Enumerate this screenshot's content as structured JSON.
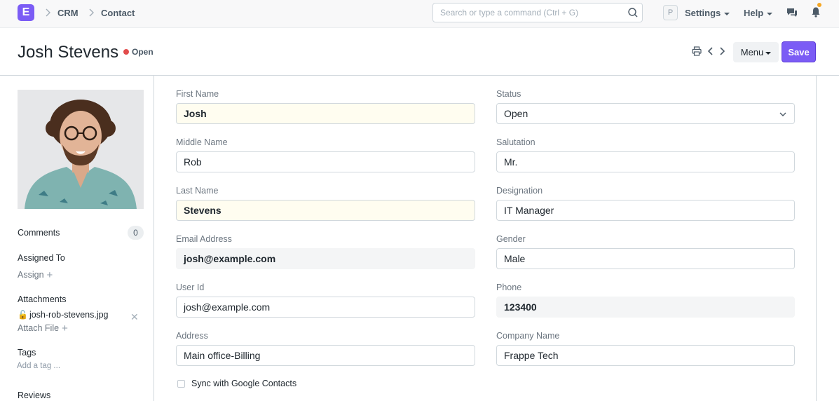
{
  "navbar": {
    "logo_letter": "E",
    "breadcrumbs": [
      "CRM",
      "Contact"
    ],
    "search_placeholder": "Search or type a command (Ctrl + G)",
    "user_initial": "P",
    "settings_label": "Settings",
    "help_label": "Help"
  },
  "titlebar": {
    "title": "Josh Stevens",
    "status": "Open",
    "menu_label": "Menu",
    "save_label": "Save"
  },
  "sidebar": {
    "comments_label": "Comments",
    "comments_count": "0",
    "assigned_label": "Assigned To",
    "assign_link": "Assign",
    "attachments_label": "Attachments",
    "attachment_name": "josh-rob-stevens.jpg",
    "attach_file_link": "Attach File",
    "tags_label": "Tags",
    "add_tag": "Add a tag ...",
    "reviews_label": "Reviews"
  },
  "form": {
    "left": [
      {
        "label": "First Name",
        "value": "Josh",
        "style": "mandatory"
      },
      {
        "label": "Middle Name",
        "value": "Rob",
        "style": "input"
      },
      {
        "label": "Last Name",
        "value": "Stevens",
        "style": "mandatory"
      },
      {
        "label": "Email Address",
        "value": "josh@example.com",
        "style": "readonly"
      },
      {
        "label": "User Id",
        "value": "josh@example.com",
        "style": "input"
      },
      {
        "label": "Address",
        "value": "Main office-Billing",
        "style": "input"
      }
    ],
    "right": [
      {
        "label": "Status",
        "value": "Open",
        "style": "select"
      },
      {
        "label": "Salutation",
        "value": "Mr.",
        "style": "input"
      },
      {
        "label": "Designation",
        "value": "IT Manager",
        "style": "input"
      },
      {
        "label": "Gender",
        "value": "Male",
        "style": "input"
      },
      {
        "label": "Phone",
        "value": "123400",
        "style": "readonly"
      },
      {
        "label": "Company Name",
        "value": "Frappe Tech",
        "style": "input"
      }
    ],
    "sync_label": "Sync with Google Contacts"
  },
  "colors": {
    "accent": "#7b5cf5",
    "status_open": "#e24c4c",
    "mandatory_bg": "#fffdf0",
    "readonly_bg": "#f4f5f6"
  }
}
